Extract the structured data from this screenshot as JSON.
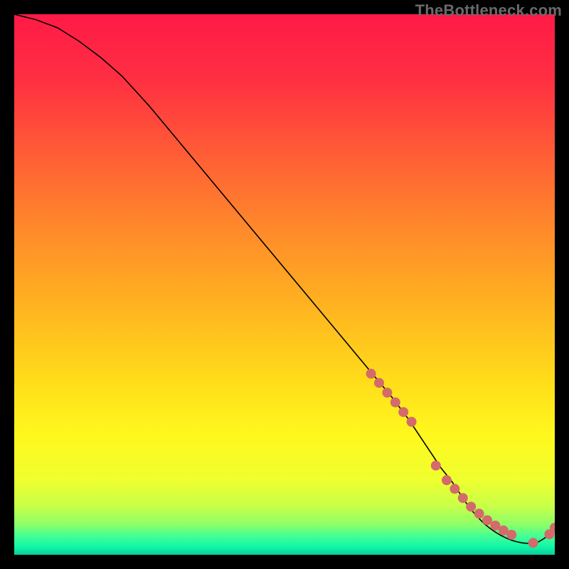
{
  "attribution": "TheBottleneck.com",
  "gradient_stops": [
    {
      "offset": 0.0,
      "color": "#ff1a47"
    },
    {
      "offset": 0.12,
      "color": "#ff2f42"
    },
    {
      "offset": 0.25,
      "color": "#ff5a36"
    },
    {
      "offset": 0.4,
      "color": "#ff8a2a"
    },
    {
      "offset": 0.55,
      "color": "#ffb61f"
    },
    {
      "offset": 0.68,
      "color": "#ffdd1a"
    },
    {
      "offset": 0.78,
      "color": "#fff81e"
    },
    {
      "offset": 0.86,
      "color": "#f0ff2e"
    },
    {
      "offset": 0.91,
      "color": "#c8ff48"
    },
    {
      "offset": 0.945,
      "color": "#8bff6a"
    },
    {
      "offset": 0.965,
      "color": "#45ff94"
    },
    {
      "offset": 0.985,
      "color": "#11f6a8"
    },
    {
      "offset": 1.0,
      "color": "#07cf99"
    }
  ],
  "dot_color": "#d46a6a",
  "dot_radius": 7,
  "chart_data": {
    "type": "line",
    "title": "",
    "xlabel": "",
    "ylabel": "",
    "xlim": [
      0,
      100
    ],
    "ylim": [
      0,
      100
    ],
    "series": [
      {
        "name": "curve",
        "x": [
          0,
          4,
          8,
          12,
          16,
          20,
          25,
          30,
          35,
          40,
          45,
          50,
          55,
          60,
          65,
          70,
          73,
          75,
          77,
          79,
          81,
          82,
          83,
          84,
          85,
          86,
          87,
          88,
          89,
          90,
          91,
          92,
          93,
          94,
          95,
          96,
          97,
          98,
          99,
          100
        ],
        "y": [
          100,
          99,
          97.5,
          95,
          92,
          88.5,
          83,
          77,
          71,
          65,
          59,
          53,
          47,
          41,
          35,
          29,
          25,
          22,
          19,
          16,
          13.5,
          12,
          10.5,
          9,
          7.8,
          6.7,
          5.7,
          4.9,
          4.2,
          3.6,
          3.1,
          2.7,
          2.4,
          2.2,
          2.1,
          2.1,
          2.4,
          3.0,
          3.8,
          5.0
        ]
      }
    ],
    "markers": {
      "name": "dotted-segment",
      "x": [
        66,
        67.5,
        69,
        70.5,
        72,
        73.5,
        78,
        80,
        81.5,
        83,
        84.5,
        86,
        87.5,
        89,
        90.5,
        92,
        96,
        99,
        100
      ],
      "y": [
        33.5,
        31.8,
        30.0,
        28.2,
        26.4,
        24.6,
        16.5,
        13.8,
        12.2,
        10.5,
        8.9,
        7.6,
        6.4,
        5.4,
        4.5,
        3.7,
        2.2,
        3.8,
        5.0
      ]
    }
  }
}
